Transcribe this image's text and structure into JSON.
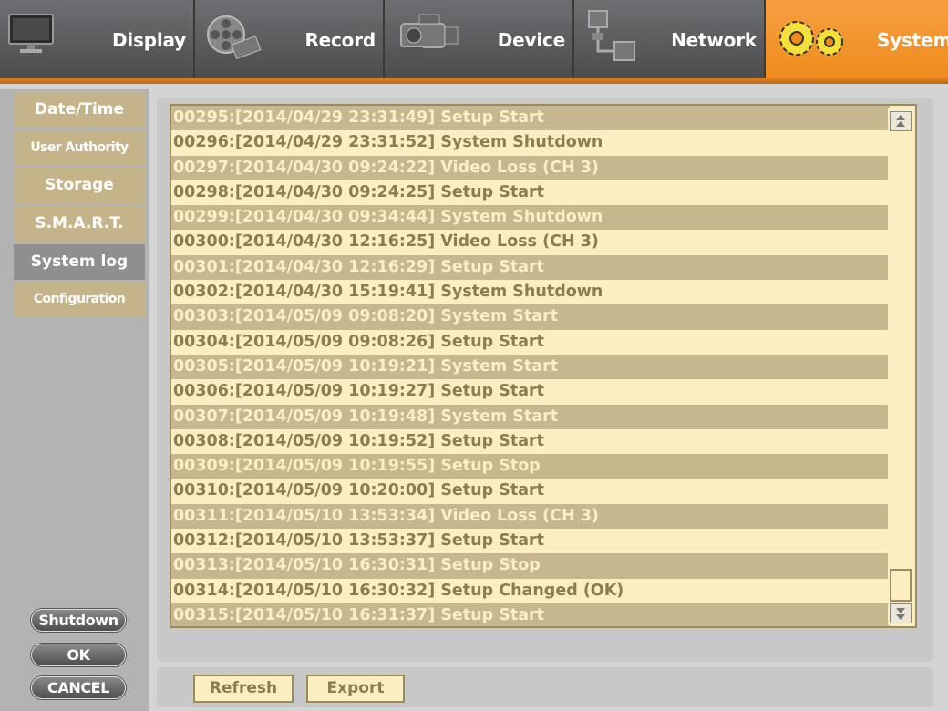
{
  "tabs": [
    {
      "label": "Display",
      "icon": "monitor-icon",
      "active": false
    },
    {
      "label": "Record",
      "icon": "film-reel-icon",
      "active": false
    },
    {
      "label": "Device",
      "icon": "video-camera-icon",
      "active": false
    },
    {
      "label": "Network",
      "icon": "network-icon",
      "active": false
    },
    {
      "label": "System",
      "icon": "gears-icon",
      "active": true
    }
  ],
  "sidebar": {
    "items": [
      {
        "label": "Date/Time",
        "active": false
      },
      {
        "label": "User Authority",
        "active": false
      },
      {
        "label": "Storage",
        "active": false
      },
      {
        "label": "S.M.A.R.T.",
        "active": false
      },
      {
        "label": "System log",
        "active": true
      },
      {
        "label": "Configuration",
        "active": false
      }
    ],
    "shutdown_label": "Shutdown",
    "ok_label": "OK",
    "cancel_label": "CANCEL"
  },
  "log": {
    "entries": [
      "00295:[2014/04/29 23:31:49] Setup Start",
      "00296:[2014/04/29 23:31:52] System Shutdown",
      "00297:[2014/04/30 09:24:22] Video Loss (CH 3)",
      "00298:[2014/04/30 09:24:25] Setup Start",
      "00299:[2014/04/30 09:34:44] System Shutdown",
      "00300:[2014/04/30 12:16:25] Video Loss (CH 3)",
      "00301:[2014/04/30 12:16:29] Setup Start",
      "00302:[2014/04/30 15:19:41] System Shutdown",
      "00303:[2014/05/09 09:08:20] System Start",
      "00304:[2014/05/09 09:08:26] Setup Start",
      "00305:[2014/05/09 10:19:21] System Start",
      "00306:[2014/05/09 10:19:27] Setup Start",
      "00307:[2014/05/09 10:19:48] System Start",
      "00308:[2014/05/09 10:19:52] Setup Start",
      "00309:[2014/05/09 10:19:55] Setup Stop",
      "00310:[2014/05/09 10:20:00] Setup Start",
      "00311:[2014/05/10 13:53:34] Video Loss (CH 3)",
      "00312:[2014/05/10 13:53:37] Setup Start",
      "00313:[2014/05/10 16:30:31] Setup Stop",
      "00314:[2014/05/10 16:30:32] Setup Changed (OK)",
      "00315:[2014/05/10 16:31:37] Setup Start"
    ]
  },
  "bottom": {
    "refresh_label": "Refresh",
    "export_label": "Export"
  },
  "colors": {
    "active_tab": "#f39433",
    "log_background": "#fbefc1",
    "log_alt_row": "#c6b78f",
    "sidebar_item": "#c5b48a"
  }
}
